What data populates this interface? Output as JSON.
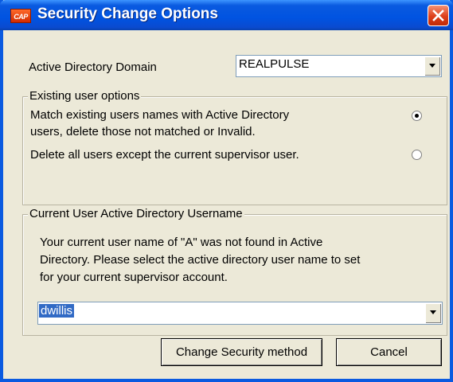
{
  "window": {
    "title": "Security Change Options",
    "icon_text": "CAP",
    "close_symbol": "close-icon"
  },
  "domain": {
    "label": "Active Directory Domain",
    "value": "REALPULSE"
  },
  "existing_options": {
    "legend": "Existing user options",
    "option1_line1": "Match existing users names with Active Directory",
    "option1_line2": "users, delete those not matched or Invalid.",
    "option2": "Delete all users except the current supervisor user.",
    "selected": "match"
  },
  "current_user": {
    "legend": "Current User Active Directory Username",
    "line1": "Your current user name of \"A\" was not found in Active",
    "line2": "Directory. Please select the active directory user name to set",
    "line3": "for your current supervisor account.",
    "username_value": "dwillis"
  },
  "buttons": {
    "change": "Change Security method",
    "cancel": "Cancel"
  },
  "colors": {
    "titlebar": "#0053e1",
    "dialog_bg": "#ece9d8",
    "selection": "#316ac5"
  }
}
